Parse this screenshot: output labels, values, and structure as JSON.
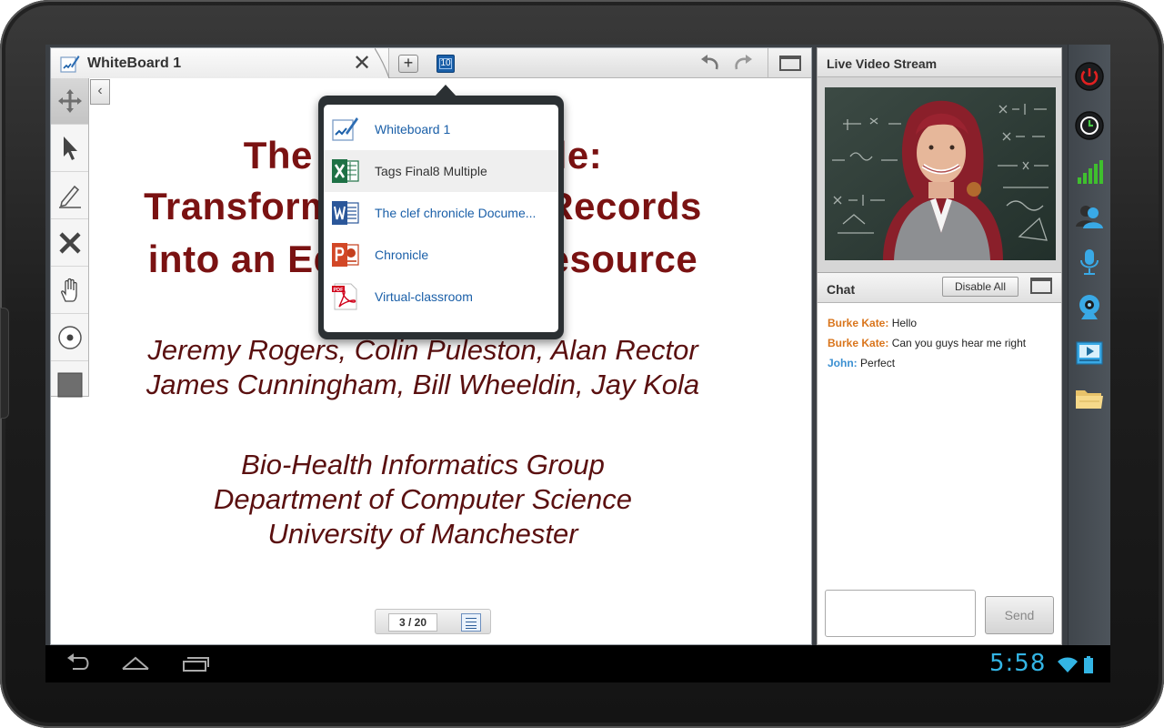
{
  "whiteboard": {
    "tab_title": "WhiteBoard 1",
    "close_glyph": "✕",
    "add_glyph": "+",
    "open_count": "10",
    "collapse_glyph": "‹",
    "tools": [
      "move-icon",
      "pointer-icon",
      "pencil-icon",
      "eraser-x-icon",
      "hand-icon",
      "circle-icon",
      "square-icon"
    ]
  },
  "slide": {
    "title_lines": [
      "The Clef Chronicle:",
      "Transforming Patient Records",
      "into an Educational Resource"
    ],
    "authors_lines": [
      "Jeremy Rogers, Colin Puleston, Alan Rector",
      "James Cunningham, Bill Wheeldin, Jay Kola"
    ],
    "affiliation_lines": [
      "Bio-Health Informatics Group",
      "Department of Computer Science",
      "University of Manchester"
    ]
  },
  "pager": {
    "page": "3 / 20"
  },
  "dropdown": {
    "items": [
      {
        "label": "Whiteboard 1",
        "icon": "whiteboard-icon"
      },
      {
        "label": "Tags Final8 Multiple",
        "icon": "excel-icon"
      },
      {
        "label": "The clef chronicle Docume...",
        "icon": "word-icon"
      },
      {
        "label": "Chronicle",
        "icon": "powerpoint-icon"
      },
      {
        "label": "Virtual-classroom",
        "icon": "pdf-icon"
      }
    ],
    "pdf_badge": "PDF"
  },
  "video": {
    "title": "Live Video Stream"
  },
  "chat": {
    "title": "Chat",
    "disable_all": "Disable All",
    "messages": [
      {
        "user": "Burke Kate:",
        "text": "Hello",
        "color": "#d9751c"
      },
      {
        "user": "Burke Kate:",
        "text": "Can you guys hear me right",
        "color": "#d9751c"
      },
      {
        "user": "John:",
        "text": "Perfect",
        "color": "#3a8fd1"
      }
    ],
    "send": "Send"
  },
  "rail": [
    "power-icon",
    "clock-icon",
    "signal-bars-icon",
    "users-icon",
    "microphone-icon",
    "webcam-icon",
    "media-player-icon",
    "folder-icon"
  ],
  "status": {
    "time": "5:58"
  },
  "colors": {
    "accent": "#1a5fa8",
    "slide_title": "#7a1212",
    "android_blue": "#33b5e5"
  }
}
